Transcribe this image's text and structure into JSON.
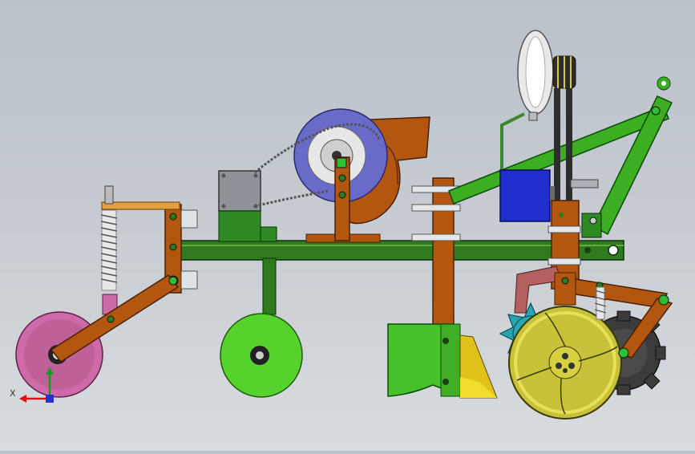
{
  "scene": {
    "name": "cad-assembly-side-view",
    "axis_triad": {
      "x_label": "X"
    },
    "colors": {
      "frame_green": "#2f7a1f",
      "bracket_orange": "#b3560f",
      "pink_wheel": "#cf6aa8",
      "green_wheel": "#56d22d",
      "yellow_wheel": "#c8c23a",
      "blue_sprocket": "#6a6ac8",
      "blue_box": "#1f2ecc",
      "hopper_green": "#45c22a",
      "teal_cam": "#2aa6b3",
      "dark_gear": "#3b3b3b",
      "motor_gray": "#8d9399",
      "belt_wheel_white": "#e9e9e9",
      "background": "#c5cbd1"
    }
  }
}
